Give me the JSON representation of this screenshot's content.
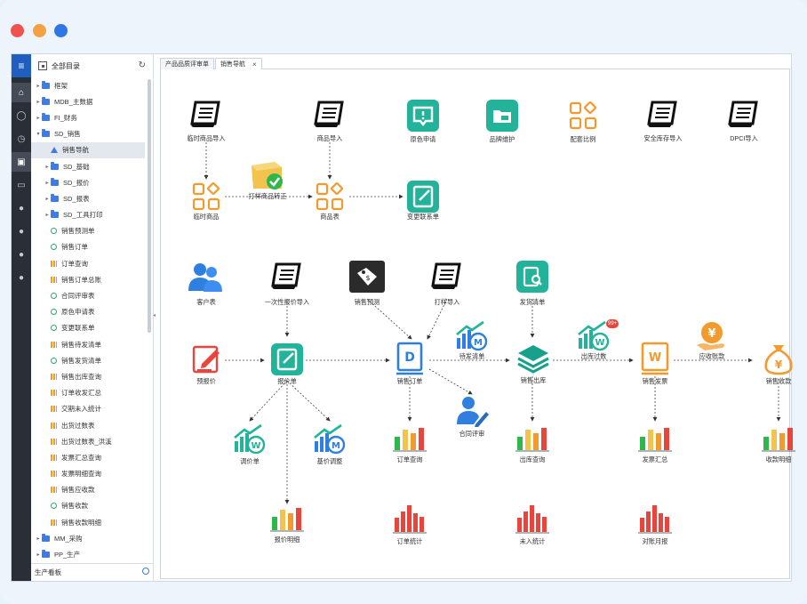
{
  "window": {
    "controls": [
      "close",
      "minimize",
      "maximize"
    ]
  },
  "tree": {
    "title": "全部目录",
    "items": [
      {
        "label": "框架",
        "type": "folder",
        "level": 0
      },
      {
        "label": "MDB_主数据",
        "type": "folder",
        "level": 0
      },
      {
        "label": "FI_财务",
        "type": "folder",
        "level": 0
      },
      {
        "label": "SD_销售",
        "type": "folder",
        "level": 0,
        "expanded": true
      },
      {
        "label": "销售导航",
        "type": "nav",
        "level": 1,
        "selected": true
      },
      {
        "label": "SD_基础",
        "type": "folder",
        "level": 1
      },
      {
        "label": "SD_报价",
        "type": "folder",
        "level": 1
      },
      {
        "label": "SD_报表",
        "type": "folder",
        "level": 1
      },
      {
        "label": "SD_工具打印",
        "type": "folder",
        "level": 1
      },
      {
        "label": "销售预测单",
        "type": "form",
        "level": 1
      },
      {
        "label": "销售订单",
        "type": "form",
        "level": 1
      },
      {
        "label": "订单查询",
        "type": "report",
        "level": 1
      },
      {
        "label": "销售订单总账",
        "type": "report",
        "level": 1
      },
      {
        "label": "合同评审表",
        "type": "form",
        "level": 1
      },
      {
        "label": "原色申请表",
        "type": "form",
        "level": 1
      },
      {
        "label": "变更联系单",
        "type": "form",
        "level": 1
      },
      {
        "label": "销售待发清单",
        "type": "report",
        "level": 1
      },
      {
        "label": "销售发货清单",
        "type": "form",
        "level": 1
      },
      {
        "label": "销售出库查询",
        "type": "report",
        "level": 1
      },
      {
        "label": "订单收发汇总",
        "type": "report",
        "level": 1
      },
      {
        "label": "交期未入统计",
        "type": "report",
        "level": 1
      },
      {
        "label": "出货过数表",
        "type": "report",
        "level": 1
      },
      {
        "label": "出货过数表_洪溪",
        "type": "report",
        "level": 1
      },
      {
        "label": "发票汇总查询",
        "type": "report",
        "level": 1
      },
      {
        "label": "发票明细查询",
        "type": "report",
        "level": 1
      },
      {
        "label": "销售应收款",
        "type": "report",
        "level": 1
      },
      {
        "label": "销售收款",
        "type": "form",
        "level": 1
      },
      {
        "label": "销售收款明细",
        "type": "report",
        "level": 1
      },
      {
        "label": "MM_采购",
        "type": "folder",
        "level": 0
      },
      {
        "label": "PP_生产",
        "type": "folder",
        "level": 0
      }
    ],
    "search_value": "生产看板"
  },
  "tabs": [
    {
      "label": "产品品质评审单",
      "active": false
    },
    {
      "label": "销售导航",
      "active": true
    }
  ],
  "nodes": {
    "n_tmp_import": "临时商品导入",
    "n_goods_import": "商品导入",
    "n_color_apply": "原色申请",
    "n_brand": "品牌维护",
    "n_ratio": "配套比例",
    "n_stock_import": "安全库存导入",
    "n_dpci": "DPCI导入",
    "n_sample_fix": "打样商品转正",
    "n_tmp_goods": "临时商品",
    "n_goods_table": "商品表",
    "n_change": "变更联系单",
    "n_customer": "客户表",
    "n_once_quote": "一次性报价导入",
    "n_forecast": "销售预测",
    "n_proof_import": "打样导入",
    "n_ship_list": "发货清单",
    "n_pre_quote": "预报价",
    "n_quote": "报价单",
    "n_order": "销售订单",
    "n_to_ship": "待发清单",
    "n_outbound": "销售出库",
    "n_out_pass": "出库过数",
    "n_invoice": "销售发票",
    "n_receivable": "应收账款",
    "n_receipt": "销售收款",
    "n_contract": "合同评审",
    "n_price_adj": "调价单",
    "n_base_adj": "基价调整",
    "n_order_query": "订单查询",
    "n_out_query": "出库查询",
    "n_inv_sum": "发票汇总",
    "n_receipt_detail": "收款明细",
    "n_quote_detail": "报价明细",
    "n_order_stat": "订单统计",
    "n_unarrived": "未入统计",
    "n_monthly": "对账月报"
  },
  "badges": {
    "out_pass": "99+"
  },
  "colors": {
    "accent": "#1f5fbf",
    "teal": "#23b39b",
    "orange": "#f29a2e",
    "red": "#e8453c",
    "blue": "#2e7fe0"
  }
}
